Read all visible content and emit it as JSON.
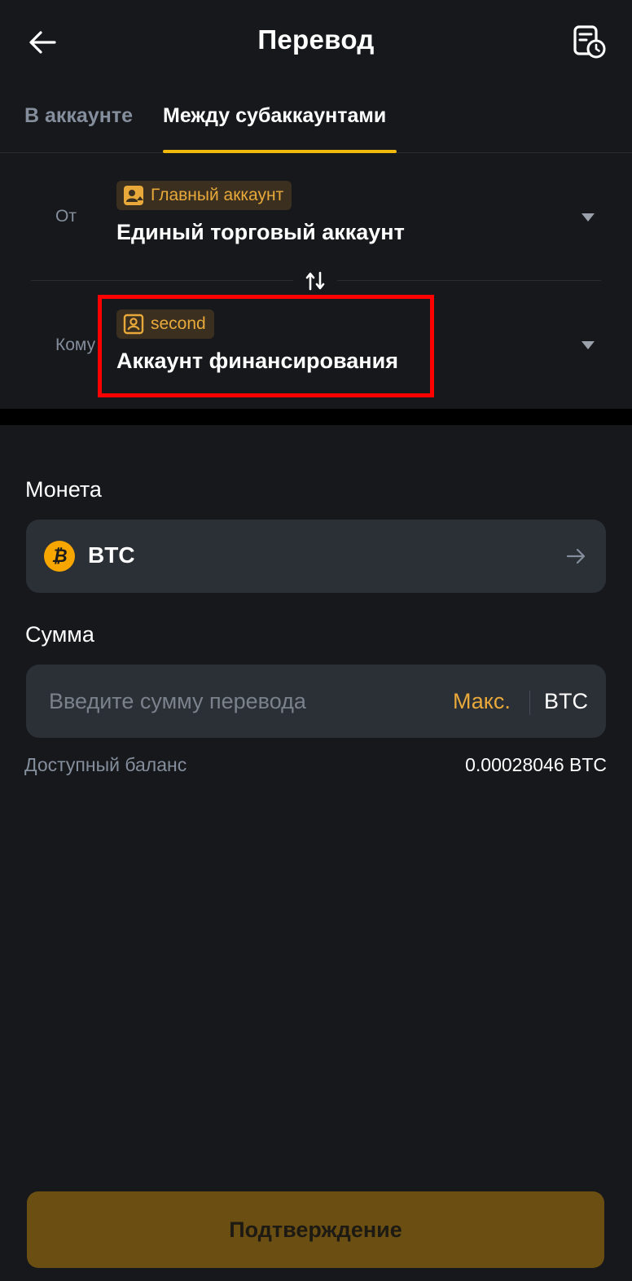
{
  "header": {
    "title": "Перевод",
    "back_icon": "arrow-left-icon",
    "history_icon": "history-document-clock-icon"
  },
  "tabs": [
    {
      "label": "В аккаунте",
      "active": false
    },
    {
      "label": "Между субаккаунтами",
      "active": true
    }
  ],
  "from": {
    "label": "От",
    "tag": "Главный аккаунт",
    "tag_icon": "main-account-user-icon",
    "account": "Единый торговый аккаунт"
  },
  "to": {
    "label": "Кому",
    "tag": "second",
    "tag_icon": "subaccount-user-icon",
    "account": "Аккаунт финансирования"
  },
  "coin": {
    "label": "Монета",
    "name": "BTC",
    "icon": "bitcoin-icon"
  },
  "amount": {
    "label": "Сумма",
    "placeholder": "Введите сумму перевода",
    "value": "",
    "max_label": "Макс.",
    "unit": "BTC"
  },
  "balance": {
    "label": "Доступный баланс",
    "value": "0.00028046 BTC"
  },
  "confirm": {
    "label": "Подтверждение"
  },
  "colors": {
    "background": "#17181c",
    "accent": "#f0b90b",
    "tag_text": "#e8a93a",
    "field_bg": "#2b2f36",
    "highlight": "#ff0000",
    "confirm_bg": "#6b4f12"
  }
}
